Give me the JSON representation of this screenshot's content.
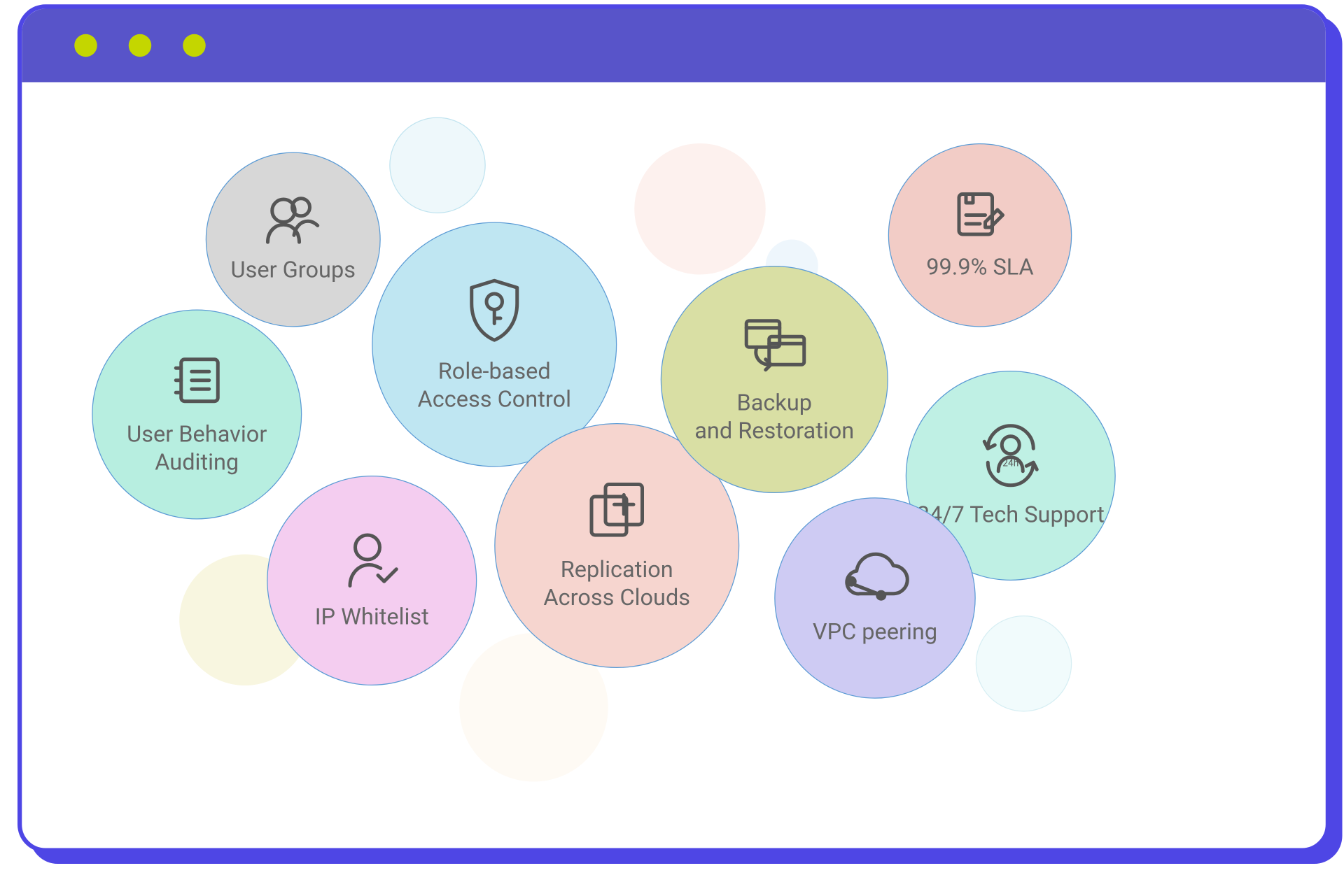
{
  "window": {
    "frame_color": "#4e46e5",
    "titlebar_color": "#5854c9",
    "dot_color": "#c4d600"
  },
  "bubbles": {
    "user_groups": {
      "label": "User Groups",
      "icon": "users-icon",
      "fill": "#d7d7d7"
    },
    "user_behavior": {
      "label": "User Behavior\nAuditing",
      "icon": "audit-log-icon",
      "fill": "#b7eee0"
    },
    "rbac": {
      "label": "Role-based\nAccess Control",
      "icon": "shield-key-icon",
      "fill": "#bfe6f2"
    },
    "ip_whitelist": {
      "label": "IP Whitelist",
      "icon": "user-check-icon",
      "fill": "#f4cdf0"
    },
    "replication": {
      "label": "Replication\nAcross Clouds",
      "icon": "duplicate-plus-icon",
      "fill": "#f6d5cf"
    },
    "backup": {
      "label": "Backup\nand Restoration",
      "icon": "backup-icon",
      "fill": "#d9dfa4"
    },
    "sla": {
      "label": "99.9% SLA",
      "icon": "document-edit-icon",
      "fill": "#f2ccc6"
    },
    "tech_support": {
      "label": "24/7 Tech Support",
      "icon": "support-24h-icon",
      "fill": "#bff0e4"
    },
    "vpc_peering": {
      "label": "VPC peering",
      "icon": "cloud-network-icon",
      "fill": "#cecbf3"
    }
  },
  "decorative_colors": {
    "pale_blue": "#eef8fb",
    "pale_pink": "#fdf1ee",
    "pale_yellow": "#f8f6e0",
    "pale_cream": "#fefaf4",
    "pale_cyan": "#f1fbfc"
  }
}
